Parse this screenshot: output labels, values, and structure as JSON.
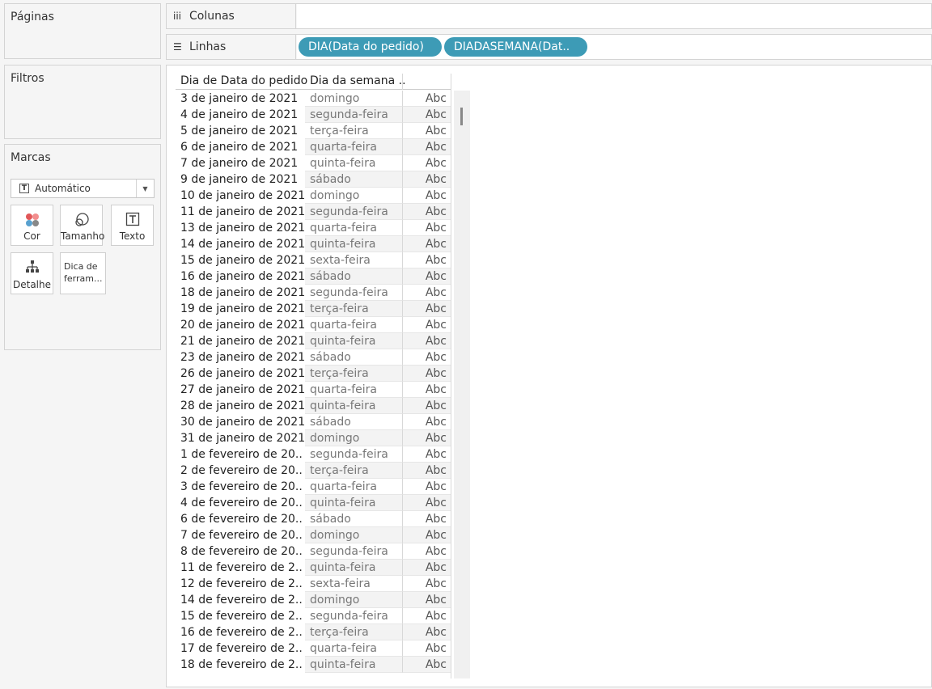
{
  "panels": {
    "pages_title": "Páginas",
    "filters_title": "Filtros",
    "marks_title": "Marcas"
  },
  "marks": {
    "type": "Automático",
    "cards": {
      "color": "Cor",
      "size": "Tamanho",
      "text": "Texto",
      "detail": "Detalhe",
      "tooltip": "Dica de ferram..."
    }
  },
  "shelves": {
    "columns_label": "Colunas",
    "rows_label": "Linhas",
    "row_pills": [
      "DIA(Data do pedido)",
      "DIADASEMANA(Dat.."
    ]
  },
  "table": {
    "headers": [
      "Dia de Data do pedido",
      "Dia da semana .."
    ],
    "rows": [
      [
        "3 de janeiro de 2021",
        "domingo",
        "Abc"
      ],
      [
        "4 de janeiro de 2021",
        "segunda-feira",
        "Abc"
      ],
      [
        "5 de janeiro de 2021",
        "terça-feira",
        "Abc"
      ],
      [
        "6 de janeiro de 2021",
        "quarta-feira",
        "Abc"
      ],
      [
        "7 de janeiro de 2021",
        "quinta-feira",
        "Abc"
      ],
      [
        "9 de janeiro de 2021",
        "sábado",
        "Abc"
      ],
      [
        "10 de janeiro de 2021",
        "domingo",
        "Abc"
      ],
      [
        "11 de janeiro de 2021",
        "segunda-feira",
        "Abc"
      ],
      [
        "13 de janeiro de 2021",
        "quarta-feira",
        "Abc"
      ],
      [
        "14 de janeiro de 2021",
        "quinta-feira",
        "Abc"
      ],
      [
        "15 de janeiro de 2021",
        "sexta-feira",
        "Abc"
      ],
      [
        "16 de janeiro de 2021",
        "sábado",
        "Abc"
      ],
      [
        "18 de janeiro de 2021",
        "segunda-feira",
        "Abc"
      ],
      [
        "19 de janeiro de 2021",
        "terça-feira",
        "Abc"
      ],
      [
        "20 de janeiro de 2021",
        "quarta-feira",
        "Abc"
      ],
      [
        "21 de janeiro de 2021",
        "quinta-feira",
        "Abc"
      ],
      [
        "23 de janeiro de 2021",
        "sábado",
        "Abc"
      ],
      [
        "26 de janeiro de 2021",
        "terça-feira",
        "Abc"
      ],
      [
        "27 de janeiro de 2021",
        "quarta-feira",
        "Abc"
      ],
      [
        "28 de janeiro de 2021",
        "quinta-feira",
        "Abc"
      ],
      [
        "30 de janeiro de 2021",
        "sábado",
        "Abc"
      ],
      [
        "31 de janeiro de 2021",
        "domingo",
        "Abc"
      ],
      [
        "1 de fevereiro de 20..",
        "segunda-feira",
        "Abc"
      ],
      [
        "2 de fevereiro de 20..",
        "terça-feira",
        "Abc"
      ],
      [
        "3 de fevereiro de 20..",
        "quarta-feira",
        "Abc"
      ],
      [
        "4 de fevereiro de 20..",
        "quinta-feira",
        "Abc"
      ],
      [
        "6 de fevereiro de 20..",
        "sábado",
        "Abc"
      ],
      [
        "7 de fevereiro de 20..",
        "domingo",
        "Abc"
      ],
      [
        "8 de fevereiro de 20..",
        "segunda-feira",
        "Abc"
      ],
      [
        "11 de fevereiro de 2..",
        "quinta-feira",
        "Abc"
      ],
      [
        "12 de fevereiro de 2..",
        "sexta-feira",
        "Abc"
      ],
      [
        "14 de fevereiro de 2..",
        "domingo",
        "Abc"
      ],
      [
        "15 de fevereiro de 2..",
        "segunda-feira",
        "Abc"
      ],
      [
        "16 de fevereiro de 2..",
        "terça-feira",
        "Abc"
      ],
      [
        "17 de fevereiro de 2..",
        "quarta-feira",
        "Abc"
      ],
      [
        "18 de fevereiro de 2..",
        "quinta-feira",
        "Abc"
      ]
    ]
  },
  "colors": {
    "pill": "#3d9bb6",
    "panel_bg": "#f5f5f5",
    "alt_row": "#f3f3f3"
  }
}
